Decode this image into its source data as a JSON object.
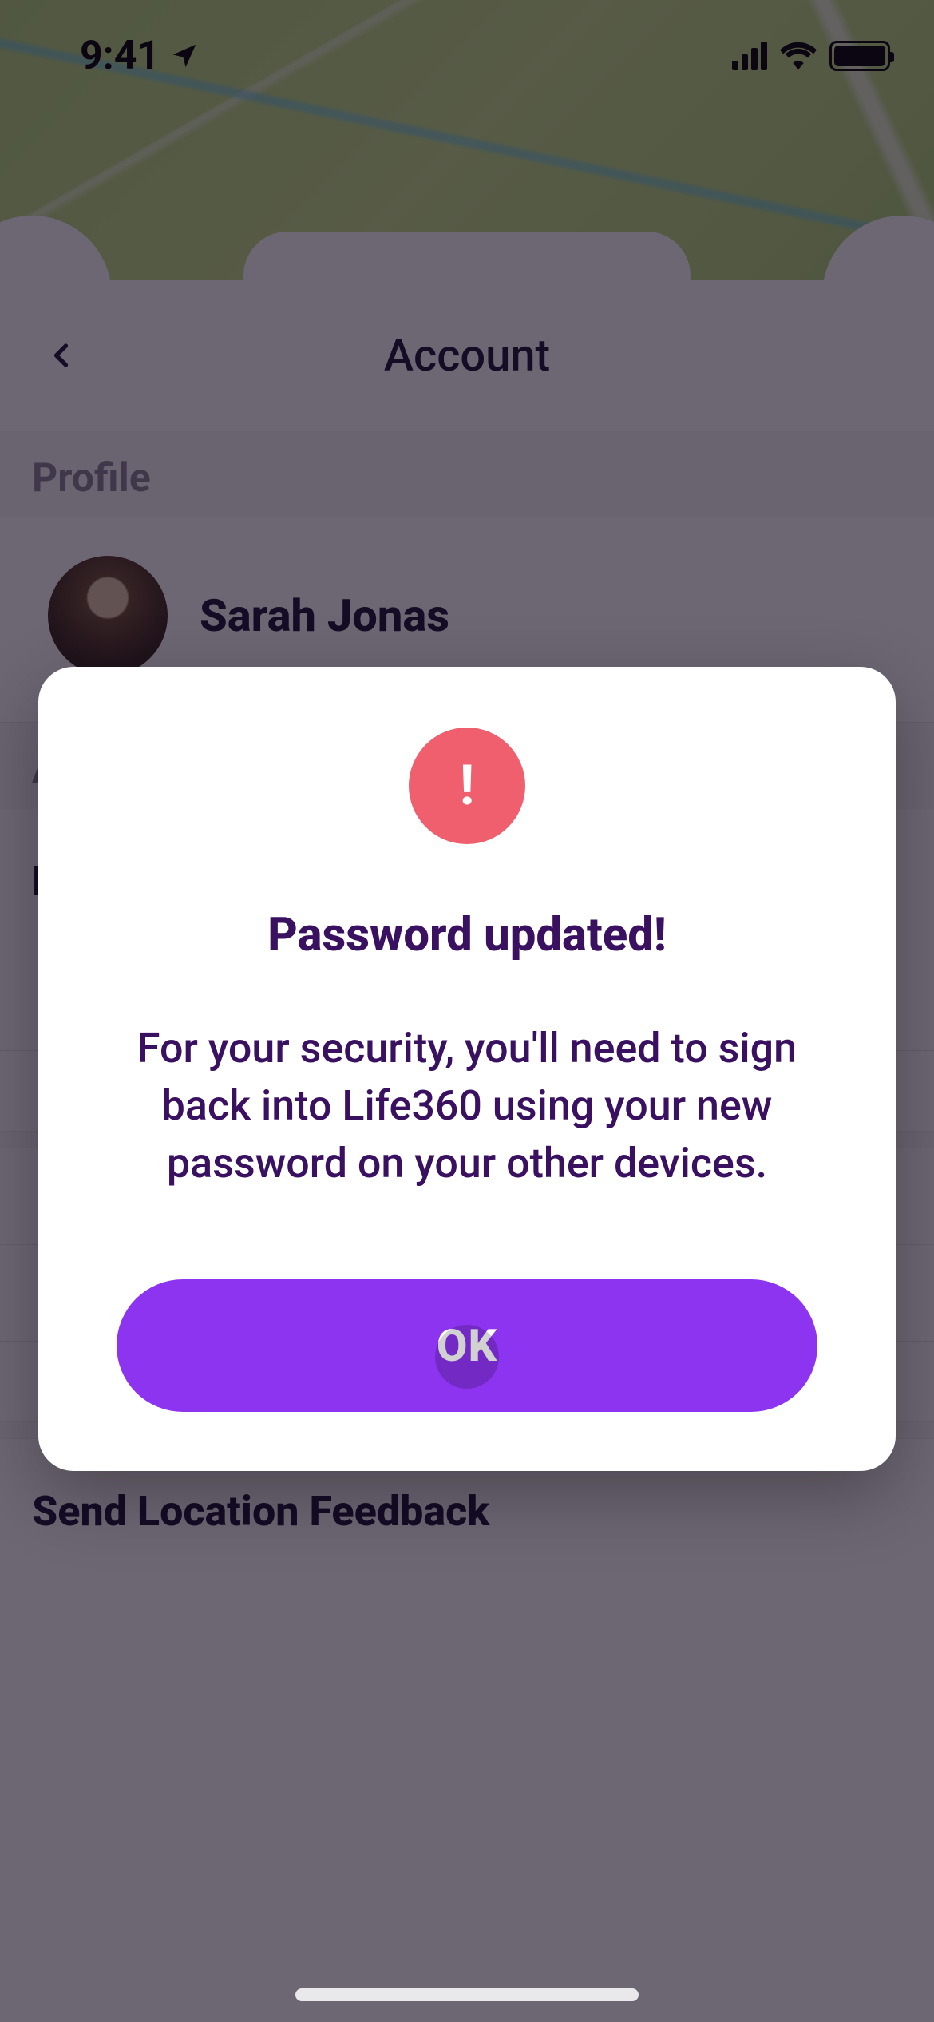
{
  "status_bar": {
    "time": "9:41"
  },
  "header": {
    "title": "Account"
  },
  "sections": {
    "profile_label": "Profile",
    "account_details_label": "Account details"
  },
  "profile": {
    "name": "Sarah Jonas"
  },
  "account_items": {
    "edit_phone": "Edit Phone Number",
    "blank1": " ",
    "blank2": " "
  },
  "other_items": {
    "i1": " ",
    "i2": " ",
    "i3": " ",
    "feedback": "Send Location Feedback"
  },
  "modal": {
    "title": "Password updated!",
    "body": "For your security, you'll need to sign back into Life360 using your new password on your other devices.",
    "ok_label": "OK",
    "icon_glyph": "!"
  }
}
